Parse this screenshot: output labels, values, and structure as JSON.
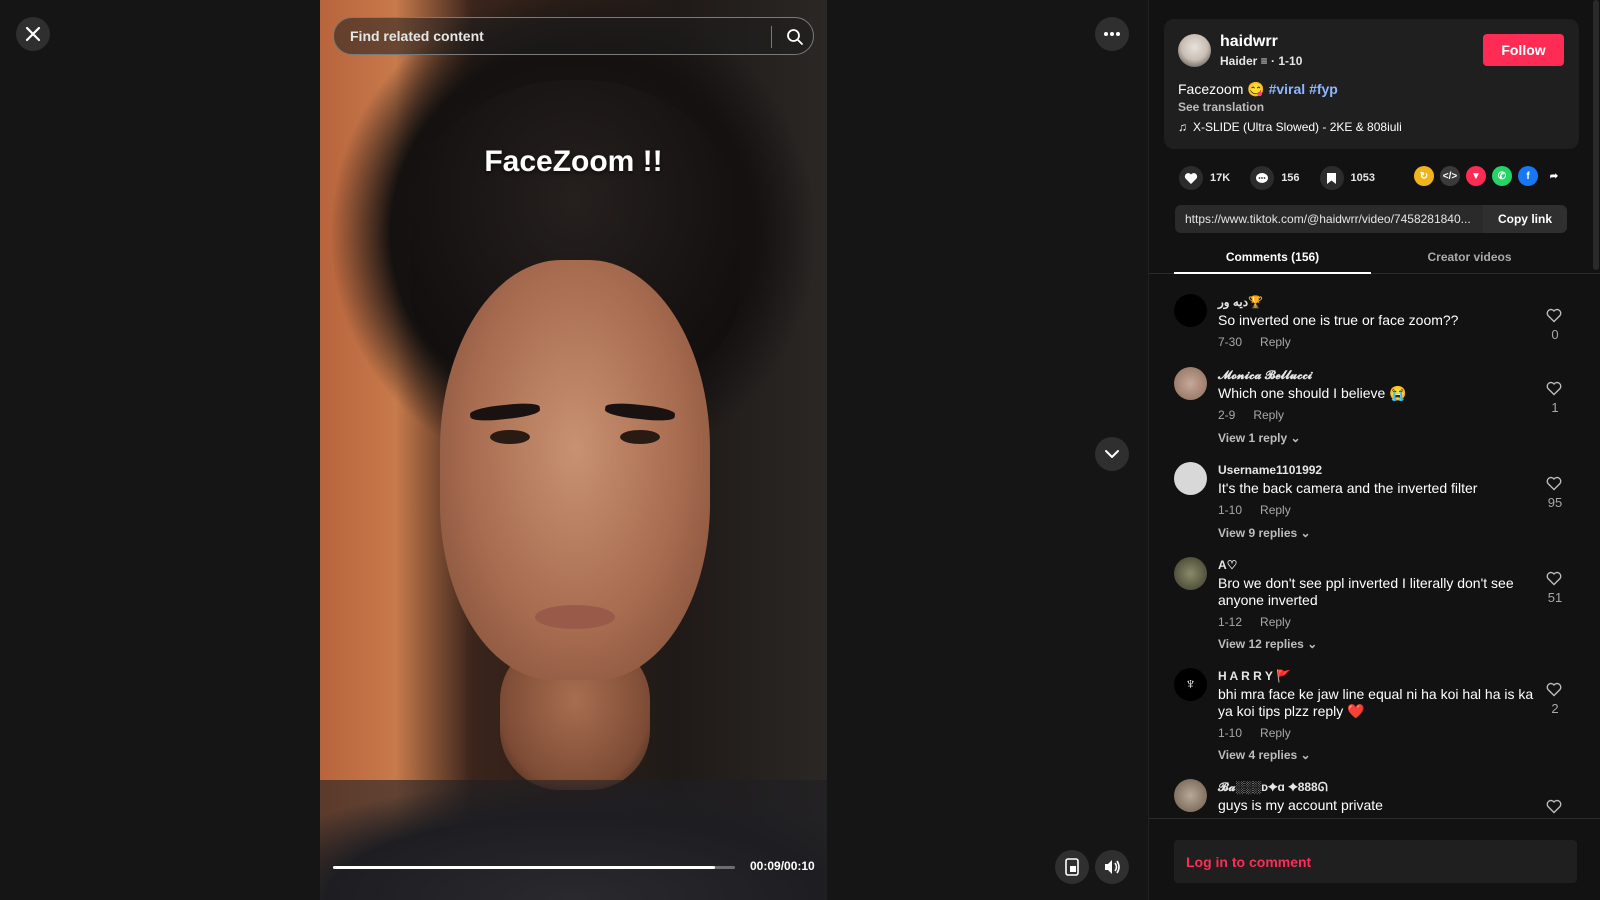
{
  "search": {
    "placeholder": "Find related content"
  },
  "video": {
    "overlay_title": "FaceZoom !!",
    "progress_fraction": 0.95,
    "timecode": "00:09/00:10"
  },
  "author": {
    "username": "haidwrr",
    "subline": "Haider ≡ · 1-10",
    "follow_label": "Follow"
  },
  "post": {
    "caption_text": "Facezoom 😋",
    "hashtags": [
      "#viral",
      "#fyp"
    ],
    "see_translation": "See translation",
    "music": "X-SLIDE (Ultra Slowed) - 2KE & 808iuli"
  },
  "stats": {
    "likes": "17K",
    "comments": "156",
    "saves": "1053"
  },
  "share_icons": [
    "repost-icon",
    "embed-icon",
    "send-icon",
    "whatsapp-icon",
    "facebook-icon",
    "share-arrow-icon"
  ],
  "link": {
    "url": "https://www.tiktok.com/@haidwrr/video/7458281840...",
    "copy_label": "Copy link"
  },
  "tabs": {
    "comments": "Comments (156)",
    "creator_videos": "Creator videos"
  },
  "comments": [
    {
      "name": "ديه ور🏆",
      "text": "So inverted one is true or face zoom??",
      "date": "7-30",
      "reply": "Reply",
      "likes": "0",
      "views": ""
    },
    {
      "name": "𝓜𝓸𝓷𝓲𝓬𝓪 𝓑𝓮𝓵𝓵𝓾𝓬𝓬𝓲",
      "text": "Which one should I believe 😭",
      "date": "2-9",
      "reply": "Reply",
      "likes": "1",
      "views": "View 1 reply"
    },
    {
      "name": "Username1101992",
      "text": "It's the back camera and the inverted filter",
      "date": "1-10",
      "reply": "Reply",
      "likes": "95",
      "views": "View 9 replies"
    },
    {
      "name": "A♡",
      "text": "Bro we don't see ppl inverted I literally don't see anyone inverted",
      "date": "1-12",
      "reply": "Reply",
      "likes": "51",
      "views": "View 12 replies"
    },
    {
      "name": "H A R R Y 🚩",
      "text": "bhi mra face ke jaw line equal ni ha koi hal ha is ka ya koi tips plzz reply ❤️",
      "date": "1-10",
      "reply": "Reply",
      "likes": "2",
      "views": "View 4 replies"
    },
    {
      "name": "𝓑𝓪░░░ᴅ✦ɑ ✦888ᘏ",
      "text": "guys is my account private",
      "date": "",
      "reply": "",
      "likes": "",
      "views": ""
    }
  ],
  "login_prompt": "Log in to comment",
  "colors": {
    "accent": "#fe2c55",
    "hashtag": "#8fb6ff",
    "panel_bg": "#121212"
  }
}
